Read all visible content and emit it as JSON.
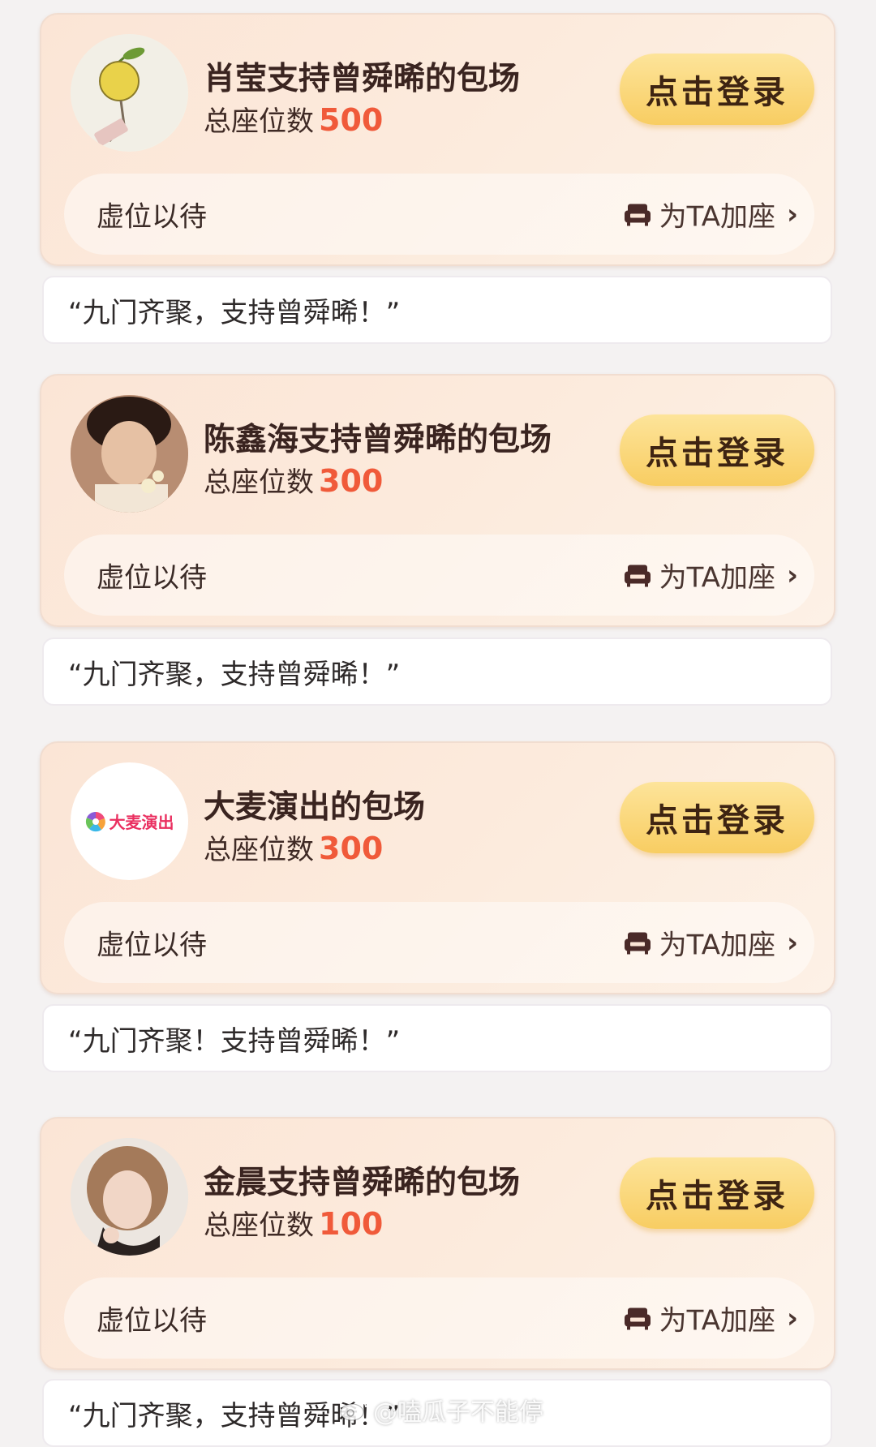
{
  "cards": [
    {
      "title": "肖莹支持曾舜晞的包场",
      "seats_label": "总座位数",
      "seats_value": "500",
      "login_label": "点击登录",
      "wait_label": "虚位以待",
      "add_seat_label": "为TA加座",
      "quote": "“九门齐聚，支持曾舜晞！”"
    },
    {
      "title": "陈鑫海支持曾舜晞的包场",
      "seats_label": "总座位数",
      "seats_value": "300",
      "login_label": "点击登录",
      "wait_label": "虚位以待",
      "add_seat_label": "为TA加座",
      "quote": "“九门齐聚，支持曾舜晞！”"
    },
    {
      "title": "大麦演出的包场",
      "seats_label": "总座位数",
      "seats_value": "300",
      "login_label": "点击登录",
      "wait_label": "虚位以待",
      "add_seat_label": "为TA加座",
      "quote": "“九门齐聚！支持曾舜晞！”",
      "avatar_logo_text": "大麦演出"
    },
    {
      "title": "金晨支持曾舜晞的包场",
      "seats_label": "总座位数",
      "seats_value": "100",
      "login_label": "点击登录",
      "wait_label": "虚位以待",
      "add_seat_label": "为TA加座",
      "quote": "“九门齐聚，支持曾舜晞！”"
    }
  ],
  "watermark": "@嗑瓜子不能停",
  "colors": {
    "card_bg": "#fbe5d6",
    "seat_count": "#f05a3a",
    "button_top": "#fde49a",
    "button_bottom": "#f8cd62",
    "quote_bg": "#ffffff"
  },
  "icons": [
    "avatar-citrus-charm",
    "avatar-man-photo",
    "damai-logo",
    "avatar-woman-photo",
    "sofa-icon",
    "chevron-right-icon"
  ]
}
